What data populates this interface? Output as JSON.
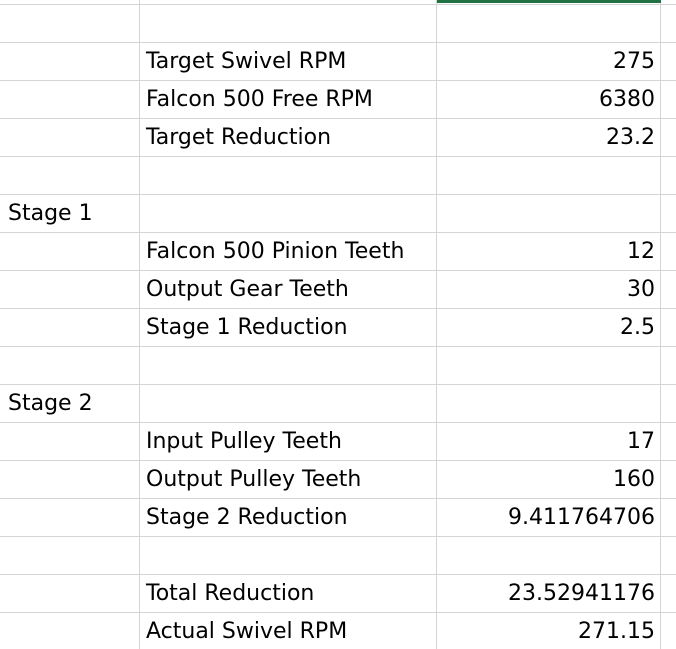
{
  "spreadsheet": {
    "accent_color": "#217346",
    "gridline_color": "#d4d4d4",
    "rows": [
      {
        "a": "",
        "b": "",
        "c": ""
      },
      {
        "a": "",
        "b": "Target Swivel RPM",
        "c": "275"
      },
      {
        "a": "",
        "b": "Falcon 500 Free RPM",
        "c": "6380"
      },
      {
        "a": "",
        "b": "Target Reduction",
        "c": "23.2"
      },
      {
        "a": "",
        "b": "",
        "c": ""
      },
      {
        "a": "Stage 1",
        "b": "",
        "c": ""
      },
      {
        "a": "",
        "b": "Falcon 500 Pinion Teeth",
        "c": "12"
      },
      {
        "a": "",
        "b": "Output Gear Teeth",
        "c": "30"
      },
      {
        "a": "",
        "b": "Stage 1 Reduction",
        "c": "2.5"
      },
      {
        "a": "",
        "b": "",
        "c": ""
      },
      {
        "a": "Stage 2",
        "b": "",
        "c": ""
      },
      {
        "a": "",
        "b": "Input Pulley Teeth",
        "c": "17"
      },
      {
        "a": "",
        "b": "Output Pulley Teeth",
        "c": "160"
      },
      {
        "a": "",
        "b": "Stage 2 Reduction",
        "c": "9.411764706"
      },
      {
        "a": "",
        "b": "",
        "c": ""
      },
      {
        "a": "",
        "b": "Total Reduction",
        "c": "23.52941176"
      },
      {
        "a": "",
        "b": "Actual Swivel RPM",
        "c": "271.15"
      }
    ]
  }
}
